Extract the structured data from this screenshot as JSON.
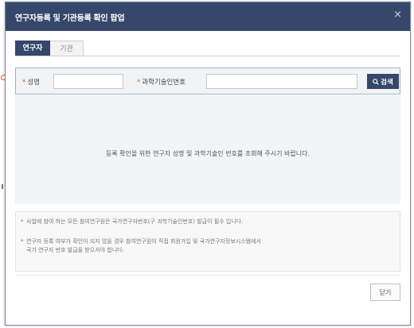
{
  "dialog": {
    "title": "연구자등록 및 기관등록 확인 팝업",
    "close_icon": "×"
  },
  "tabs": [
    {
      "label": "연구자",
      "active": true
    },
    {
      "label": "기관",
      "active": false
    }
  ],
  "search": {
    "name_label": "성명",
    "number_label": "과학기술인번호",
    "required_mark": "*",
    "name_value": "",
    "number_value": "",
    "button_label": "검색",
    "button_icon": "search-icon"
  },
  "result": {
    "message": "등록 확인을 위한 연구자 성명 및 과학기술인 번호를 조회해 주시기 바랍니다."
  },
  "notes": [
    {
      "bullet": "*",
      "text": "사업에 참여 하는 모든 참여연구원은 국가연구자번호(구 과학기술인번호) 발급이 필수 입니다."
    },
    {
      "bullet": "*",
      "text": "연구자 등록 여부가 확인이 되지 않을 경우 참여연구원이 직접 회원가입 및 국가연구자정보시스템에서",
      "text2": "국가 연구자 번호 발급을 받으셔야 합니다."
    }
  ],
  "footer": {
    "close_label": "닫기"
  },
  "colors": {
    "header_bg": "#35476a",
    "accent": "#35476a",
    "required": "#d9534f"
  }
}
